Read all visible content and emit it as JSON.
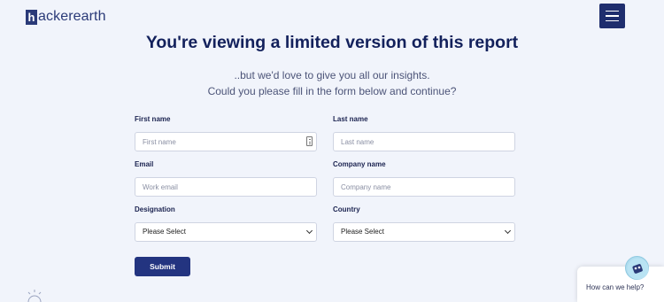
{
  "brand": {
    "logo_mark": "h",
    "logo_text": "ackerearth"
  },
  "header": {
    "menu_icon": "hamburger-icon"
  },
  "hero": {
    "title": "You're viewing a limited version of this report",
    "line1": "..but we'd love to give you all our insights.",
    "line2": "Could you please fill in the form below and continue?"
  },
  "form": {
    "first_name": {
      "label": "First name",
      "placeholder": "First name"
    },
    "last_name": {
      "label": "Last name",
      "placeholder": "Last name"
    },
    "email": {
      "label": "Email",
      "placeholder": "Work email"
    },
    "company": {
      "label": "Company name",
      "placeholder": "Company name"
    },
    "designation": {
      "label": "Designation",
      "value": "Please Select"
    },
    "country": {
      "label": "Country",
      "value": "Please Select"
    },
    "submit_label": "Submit"
  },
  "chat": {
    "prompt": "How can we help?"
  },
  "colors": {
    "brand": "#233480",
    "background": "#f1f4fb",
    "title": "#13215c"
  }
}
